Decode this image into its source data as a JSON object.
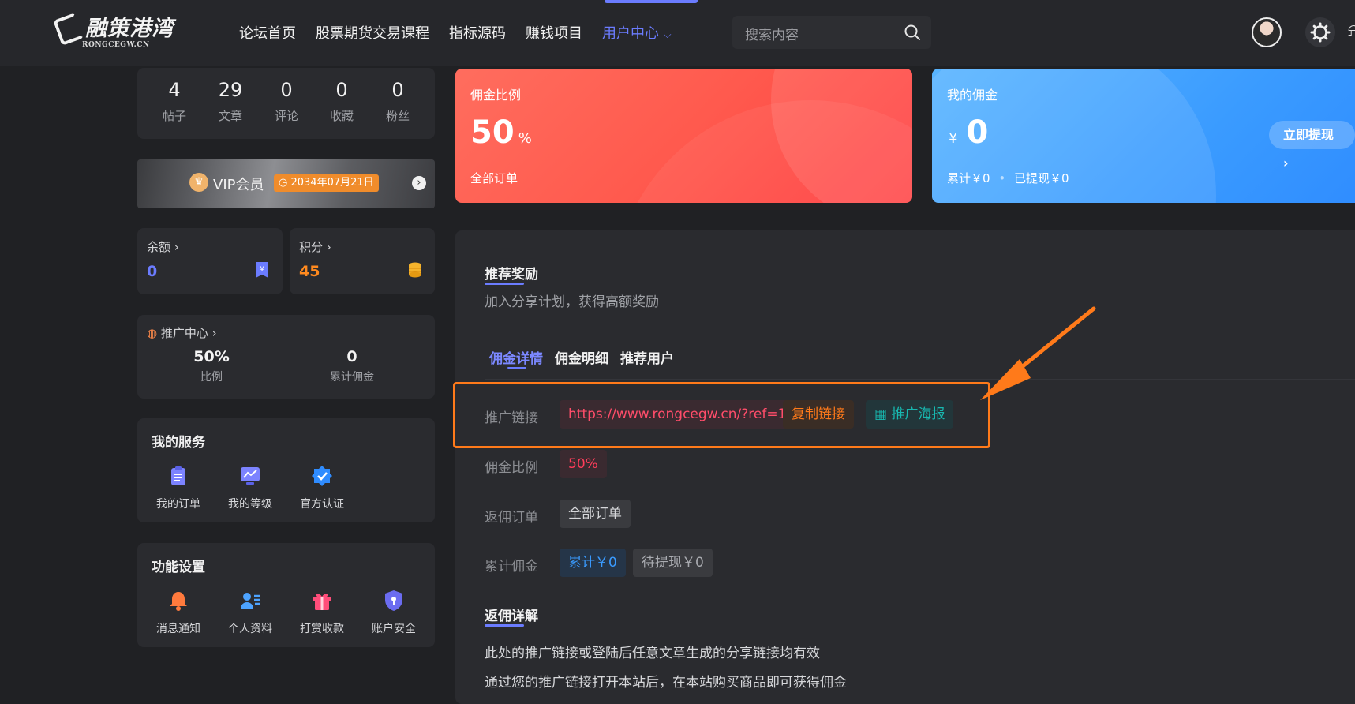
{
  "header": {
    "logo_text": "融策港湾",
    "logo_sub": "RONGCEGW.CN",
    "nav": [
      "论坛首页",
      "股票期货交易课程",
      "指标源码",
      "赚钱项目",
      "用户中心"
    ],
    "nav_active_index": 4,
    "search_placeholder": "搜索内容"
  },
  "stats": [
    {
      "value": "4",
      "label": "帖子"
    },
    {
      "value": "29",
      "label": "文章"
    },
    {
      "value": "0",
      "label": "评论"
    },
    {
      "value": "0",
      "label": "收藏"
    },
    {
      "value": "0",
      "label": "粉丝"
    }
  ],
  "vip": {
    "label": "VIP会员",
    "expire": "2034年07月21日"
  },
  "balance": {
    "label": "余额",
    "value": "0",
    "color": "#6b7cff"
  },
  "points": {
    "label": "积分",
    "value": "45",
    "color": "#ff8a1f"
  },
  "promo": {
    "title": "推广中心",
    "ratio": "50%",
    "ratio_label": "比例",
    "total": "0",
    "total_label": "累计佣金"
  },
  "services": {
    "title": "我的服务",
    "items": [
      "我的订单",
      "我的等级",
      "官方认证"
    ]
  },
  "functions": {
    "title": "功能设置",
    "items": [
      "消息通知",
      "个人资料",
      "打赏收款",
      "账户安全"
    ]
  },
  "commission_card": {
    "label": "佣金比例",
    "value": "50",
    "unit": "%",
    "sub": "全部订单"
  },
  "my_commission": {
    "label": "我的佣金",
    "currency": "¥",
    "value": "0",
    "total": "累计￥0",
    "withdrawn": "已提现￥0",
    "button": "立即提现"
  },
  "referral": {
    "title": "推荐奖励",
    "subtitle": "加入分享计划，获得高额奖励",
    "tabs": [
      "佣金详情",
      "佣金明细",
      "推荐用户"
    ],
    "link_label": "推广链接",
    "link": "https://www.rongcegw.cn/?ref=1",
    "copy_button": "复制链接",
    "poster_button": "推广海报",
    "ratio_label": "佣金比例",
    "ratio": "50%",
    "orders_label": "返佣订单",
    "orders": "全部订单",
    "accum_label": "累计佣金",
    "accum": "累计￥0",
    "pending": "待提现￥0"
  },
  "details": {
    "title": "返佣详解",
    "lines": [
      "此处的推广链接或登陆后任意文章生成的分享链接均有效",
      "通过您的推广链接打开本站后，在本站购买商品即可获得佣金"
    ]
  },
  "colors": {
    "accent": "#6b7cff",
    "highlight": "#ff7a1a",
    "red_card": "#ff5a4e",
    "blue_card": "#3a9bff"
  }
}
